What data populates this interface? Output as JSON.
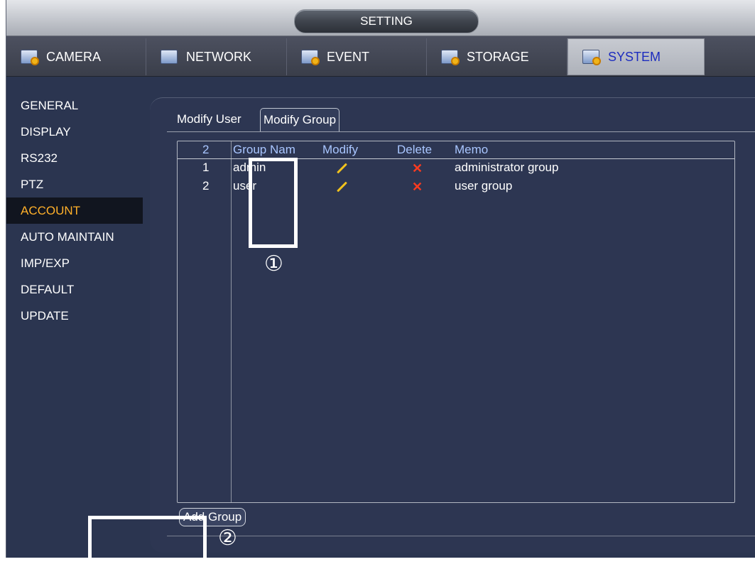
{
  "window": {
    "title": "SETTING"
  },
  "main_tabs": [
    {
      "label": "CAMERA",
      "icon": "camera-settings-icon"
    },
    {
      "label": "NETWORK",
      "icon": "network-settings-icon"
    },
    {
      "label": "EVENT",
      "icon": "event-settings-icon"
    },
    {
      "label": "STORAGE",
      "icon": "storage-settings-icon"
    },
    {
      "label": "SYSTEM",
      "icon": "system-settings-icon",
      "active": true
    }
  ],
  "sidebar": {
    "items": [
      {
        "label": "GENERAL"
      },
      {
        "label": "DISPLAY"
      },
      {
        "label": "RS232"
      },
      {
        "label": "PTZ"
      },
      {
        "label": "ACCOUNT",
        "active": true
      },
      {
        "label": "AUTO MAINTAIN"
      },
      {
        "label": "IMP/EXP"
      },
      {
        "label": "DEFAULT"
      },
      {
        "label": "UPDATE"
      }
    ]
  },
  "subtabs": [
    {
      "label": "Modify User"
    },
    {
      "label": "Modify Group",
      "active": true
    }
  ],
  "table": {
    "count": "2",
    "headers": {
      "group_name": "Group Nam",
      "modify": "Modify",
      "delete": "Delete",
      "memo": "Memo"
    },
    "rows": [
      {
        "index": "1",
        "group_name": "admin",
        "memo": "administrator group"
      },
      {
        "index": "2",
        "group_name": "user",
        "memo": "user group"
      }
    ]
  },
  "buttons": {
    "add_group": "Add Group"
  },
  "annotations": {
    "marker_1": "①",
    "marker_2": "②"
  },
  "colors": {
    "active_sidebar_text": "#ffb02a",
    "active_tab_text": "#1c2cbf",
    "header_text": "#a9c6ff",
    "delete_icon": "#ff3b1f",
    "modify_icon": "#f1c21d"
  }
}
